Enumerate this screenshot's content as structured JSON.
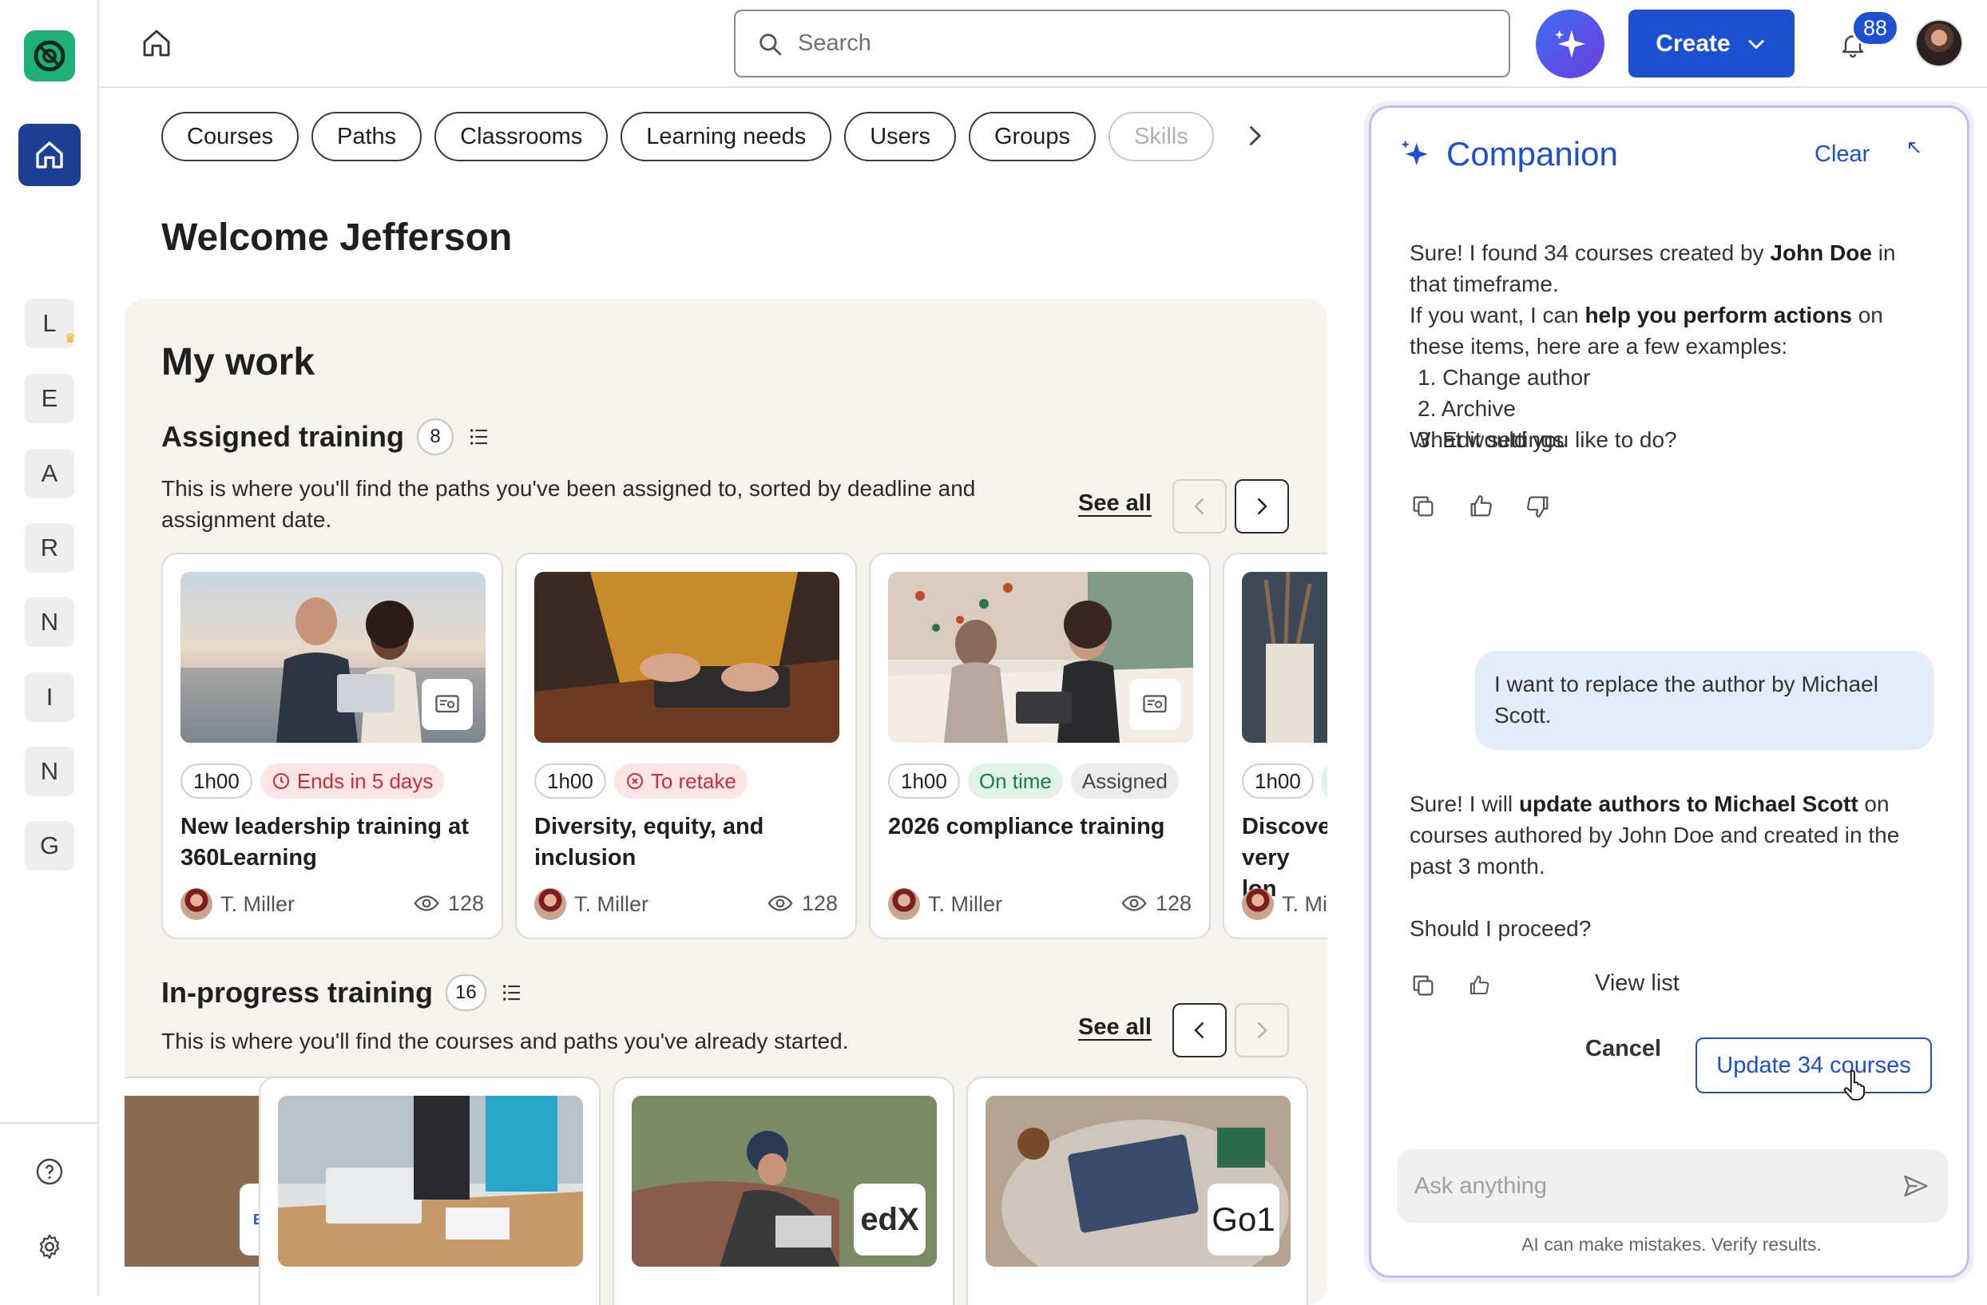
{
  "topbar": {
    "search_placeholder": "Search",
    "create_label": "Create",
    "notifications_count": "88"
  },
  "rail": {
    "workspaces": [
      "L",
      "E",
      "A",
      "R",
      "N",
      "I",
      "N",
      "G"
    ]
  },
  "filters": [
    "Courses",
    "Paths",
    "Classrooms",
    "Learning needs",
    "Users",
    "Groups",
    "Skills"
  ],
  "welcome": "Welcome Jefferson",
  "my_work": {
    "title": "My work",
    "assigned": {
      "title": "Assigned training",
      "count": "8",
      "description": "This is where you'll find the paths you've been assigned to, sorted by deadline and assignment date.",
      "see_all": "See all",
      "cards": [
        {
          "duration": "1h00",
          "status": "Ends in 5 days",
          "status_extra": "",
          "title": "New leadership training at 360Learning",
          "author": "T. Miller",
          "views": "128"
        },
        {
          "duration": "1h00",
          "status": "To retake",
          "status_extra": "",
          "title": "Diversity, equity, and inclusion",
          "author": "T. Miller",
          "views": "128"
        },
        {
          "duration": "1h00",
          "status": "On time",
          "status_extra": "Assigned",
          "title": "2026 compliance training",
          "author": "T. Miller",
          "views": "128"
        },
        {
          "duration": "1h00",
          "status": "",
          "status_extra": "",
          "title": "Discover very lon",
          "author": "T. Mi",
          "views": ""
        }
      ]
    },
    "in_progress": {
      "title": "In-progress training",
      "count": "16",
      "description": "This is where you'll find the courses and paths you've already started.",
      "see_all": "See all",
      "brands": [
        "Busuu",
        "edX",
        "Go1"
      ]
    }
  },
  "companion": {
    "title": "Companion",
    "clear_label": "Clear",
    "msg1_a": "Sure! I found 34 courses created by ",
    "msg1_b": "John Doe",
    "msg1_c": " in that timeframe.",
    "msg2_a": "If you want, I can ",
    "msg2_b": "help you perform actions",
    "msg2_c": " on these items, here are a few examples:",
    "examples": [
      "1. Change author",
      "2. Archive",
      "3. Edit settings"
    ],
    "question": "What would you like to do?",
    "user_message": "I want to replace the author by Michael Scott.",
    "msg3_a": "Sure! I will ",
    "msg3_b": "update authors to Michael Scott",
    "msg3_c": " on courses authored by John Doe and created in the past 3 month.",
    "proceed": "Should I proceed?",
    "view_list": "View list",
    "cancel_label": "Cancel",
    "update_label": "Update 34 courses",
    "input_placeholder": "Ask anything",
    "disclaimer": "AI can make mistakes. Verify results."
  },
  "colors": {
    "primary": "#1c4fd1",
    "rail_active": "#1c3f94",
    "logo": "#1fb07a",
    "panel_bg": "#f6f3ee",
    "companion_border": "#c7baf5"
  }
}
